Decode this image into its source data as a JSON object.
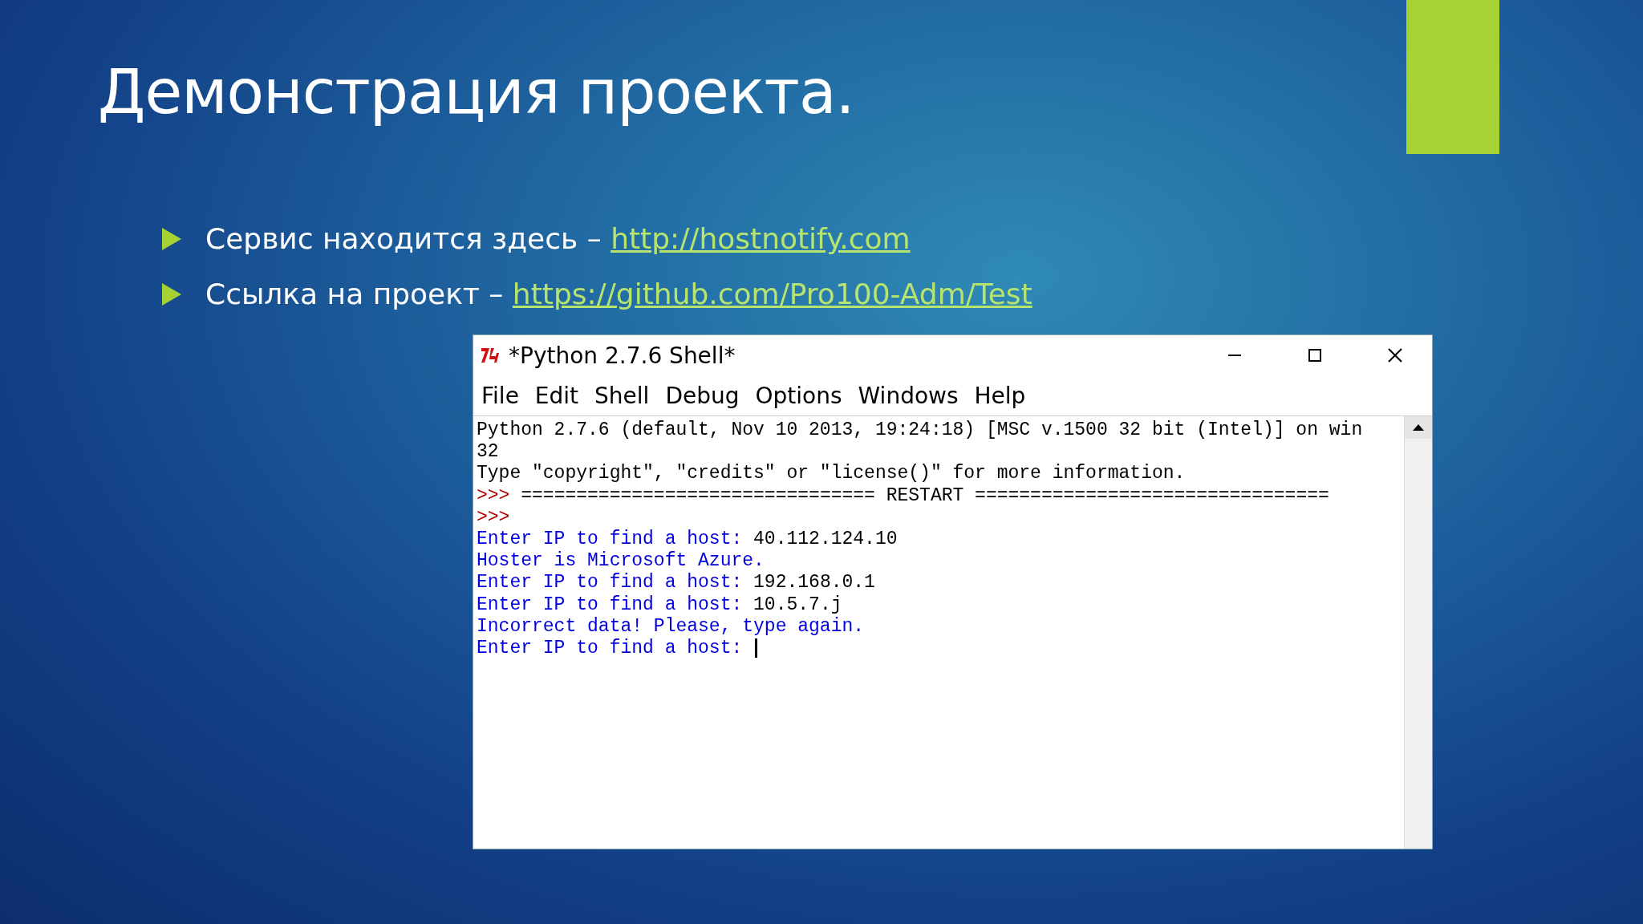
{
  "slide": {
    "title": "Демонстрация проекта.",
    "bullets": [
      {
        "text": "Сервис находится здесь – ",
        "link": "http://hostnotify.com"
      },
      {
        "text": "Ссылка на проект – ",
        "link": "https://github.com/Pro100-Adm/Test"
      }
    ]
  },
  "shell_window": {
    "title": "*Python 2.7.6 Shell*",
    "menu": [
      "File",
      "Edit",
      "Shell",
      "Debug",
      "Options",
      "Windows",
      "Help"
    ],
    "console": {
      "cursor": true,
      "lines": [
        [
          {
            "kind": "info",
            "text": "Python 2.7.6 (default, Nov 10 2013, 19:24:18) [MSC v.1500 32 bit (Intel)] on win"
          }
        ],
        [
          {
            "kind": "info",
            "text": "32"
          }
        ],
        [
          {
            "kind": "info",
            "text": "Type \"copyright\", \"credits\" or \"license()\" for more information."
          }
        ],
        [
          {
            "kind": "prompt",
            "text": ">>> "
          },
          {
            "kind": "info",
            "text": "================================ RESTART ================================"
          }
        ],
        [
          {
            "kind": "prompt",
            "text": ">>>"
          }
        ],
        [
          {
            "kind": "stdout",
            "text": "Enter IP to find a host: "
          },
          {
            "kind": "stdin",
            "text": "40.112.124.10"
          }
        ],
        [
          {
            "kind": "stdout",
            "text": "Hoster is Microsoft Azure."
          }
        ],
        [
          {
            "kind": "stdout",
            "text": "Enter IP to find a host: "
          },
          {
            "kind": "stdin",
            "text": "192.168.0.1"
          }
        ],
        [
          {
            "kind": "stdout",
            "text": "Enter IP to find a host: "
          },
          {
            "kind": "stdin",
            "text": "10.5.7.j"
          }
        ],
        [
          {
            "kind": "stdout",
            "text": "Incorrect data! Please, type again."
          }
        ],
        [
          {
            "kind": "stdout",
            "text": "Enter IP to find a host: "
          }
        ]
      ]
    }
  }
}
